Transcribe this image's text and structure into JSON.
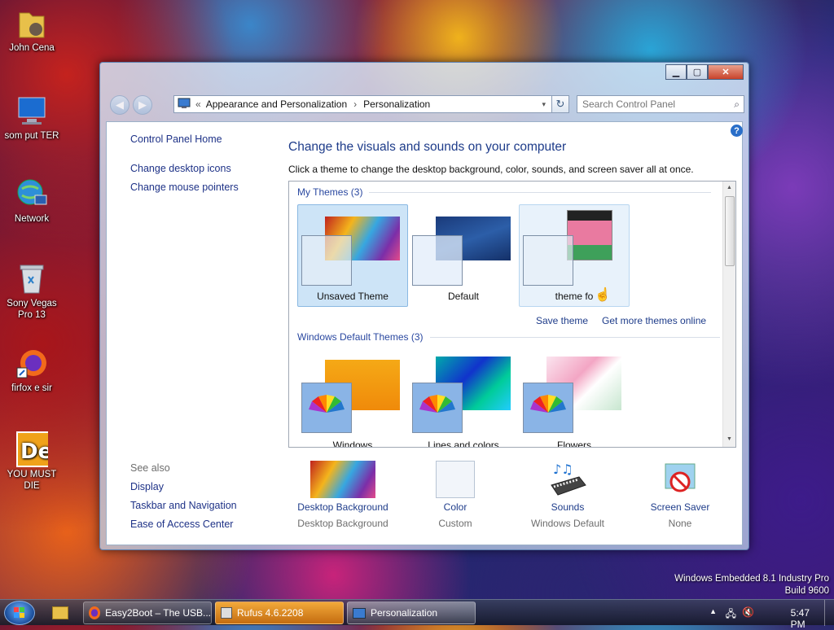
{
  "desktop": {
    "icons": [
      {
        "label": "John Cena",
        "icon": "folder-icon"
      },
      {
        "label": "som put TER",
        "icon": "computer-icon"
      },
      {
        "label": "Network",
        "icon": "network-icon"
      },
      {
        "label": "Sony Vegas Pro 13",
        "icon": "recycle-bin-icon"
      },
      {
        "label": "firfox e sir",
        "icon": "firefox-icon"
      },
      {
        "label": "YOU MUST DIE",
        "icon": "de-icon"
      }
    ],
    "watermark_line1": "Windows Embedded 8.1 Industry Pro",
    "watermark_line2": "Build 9600"
  },
  "window": {
    "address": {
      "prefix": "«",
      "crumbs": [
        "Appearance and Personalization",
        "Personalization"
      ]
    },
    "search": {
      "placeholder": "Search Control Panel"
    },
    "left_nav": {
      "home": "Control Panel Home",
      "links": [
        "Change desktop icons",
        "Change mouse pointers"
      ],
      "see_also_title": "See also",
      "see_also": [
        "Display",
        "Taskbar and Navigation",
        "Ease of Access Center"
      ]
    },
    "heading": "Change the visuals and sounds on your computer",
    "subheading": "Click a theme to change the desktop background, color, sounds, and screen saver all at once.",
    "my_themes": {
      "label": "My Themes (3)",
      "items": [
        {
          "name": "Unsaved Theme",
          "selected": true
        },
        {
          "name": "Default",
          "selected": false
        },
        {
          "name": "theme fo",
          "selected": false
        }
      ]
    },
    "save_theme": "Save theme",
    "get_more": "Get more themes online",
    "default_themes": {
      "label": "Windows Default Themes (3)",
      "items": [
        "Windows",
        "Lines and colors",
        "Flowers"
      ]
    },
    "bottom": [
      {
        "link": "Desktop Background",
        "value": "Desktop Background",
        "icon": "desktop-background-thumbnail"
      },
      {
        "link": "Color",
        "value": "Custom",
        "icon": "color-swatch-icon"
      },
      {
        "link": "Sounds",
        "value": "Windows Default",
        "icon": "sounds-icon"
      },
      {
        "link": "Screen Saver",
        "value": "None",
        "icon": "screen-saver-icon"
      }
    ]
  },
  "taskbar": {
    "buttons": [
      "Easy2Boot – The USB...",
      "Rufus 4.6.2208",
      "Personalization"
    ],
    "time": "5:47 PM"
  },
  "colors": {
    "link": "#1e3c8a",
    "selection": "#cde4f7"
  }
}
